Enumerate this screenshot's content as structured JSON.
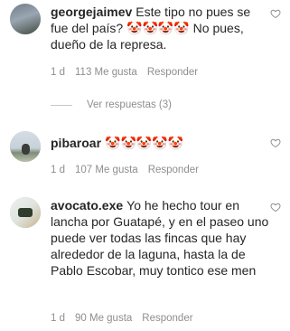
{
  "comments": [
    {
      "username": "georgejaimev",
      "text": "Este tipo no pues se fue del país? 🤡🤡🤡🤡 No pues, dueño de la represa.",
      "age": "1 d",
      "likes": "113 Me gusta",
      "reply_label": "Responder"
    },
    {
      "username": "pibaroar",
      "text": "🤡🤡🤡🤡🤡",
      "age": "1 d",
      "likes": "107 Me gusta",
      "reply_label": "Responder"
    },
    {
      "username": "avocato.exe",
      "text": "Yo he hecho tour en lancha por Guatapé, y en el paseo uno puede ver todas las fincas que hay alrededor de la laguna, hasta la de Pablo Escobar, muy tontico ese men",
      "age": "1 d",
      "likes": "90 Me gusta",
      "reply_label": "Responder"
    }
  ],
  "view_replies": "Ver respuestas (3)",
  "icons": {
    "like": "heart-outline-icon"
  },
  "colors": {
    "text": "#262626",
    "muted": "#8e8e8e",
    "divider": "#c7c7c7"
  }
}
